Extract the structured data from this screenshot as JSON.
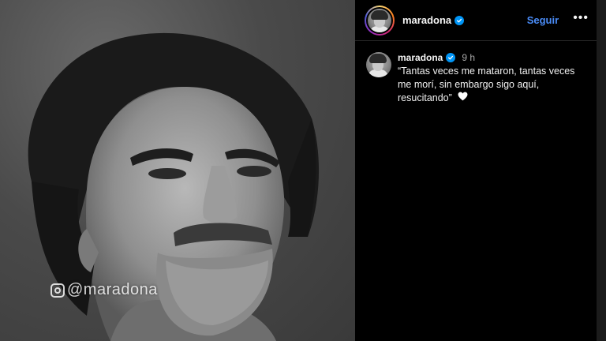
{
  "post": {
    "watermark": "@maradona",
    "image_subject": "black-and-white portrait"
  },
  "header": {
    "username": "maradona",
    "follow_label": "Seguir",
    "more_label": "•••"
  },
  "comment": {
    "username": "maradona",
    "time": "9 h",
    "text": "“Tantas veces me mataron, tantas veces me morí, sin embargo sigo aquí, resucitando”"
  },
  "colors": {
    "background": "#000000",
    "verified": "#0095f6",
    "follow": "#4a8cf7"
  }
}
